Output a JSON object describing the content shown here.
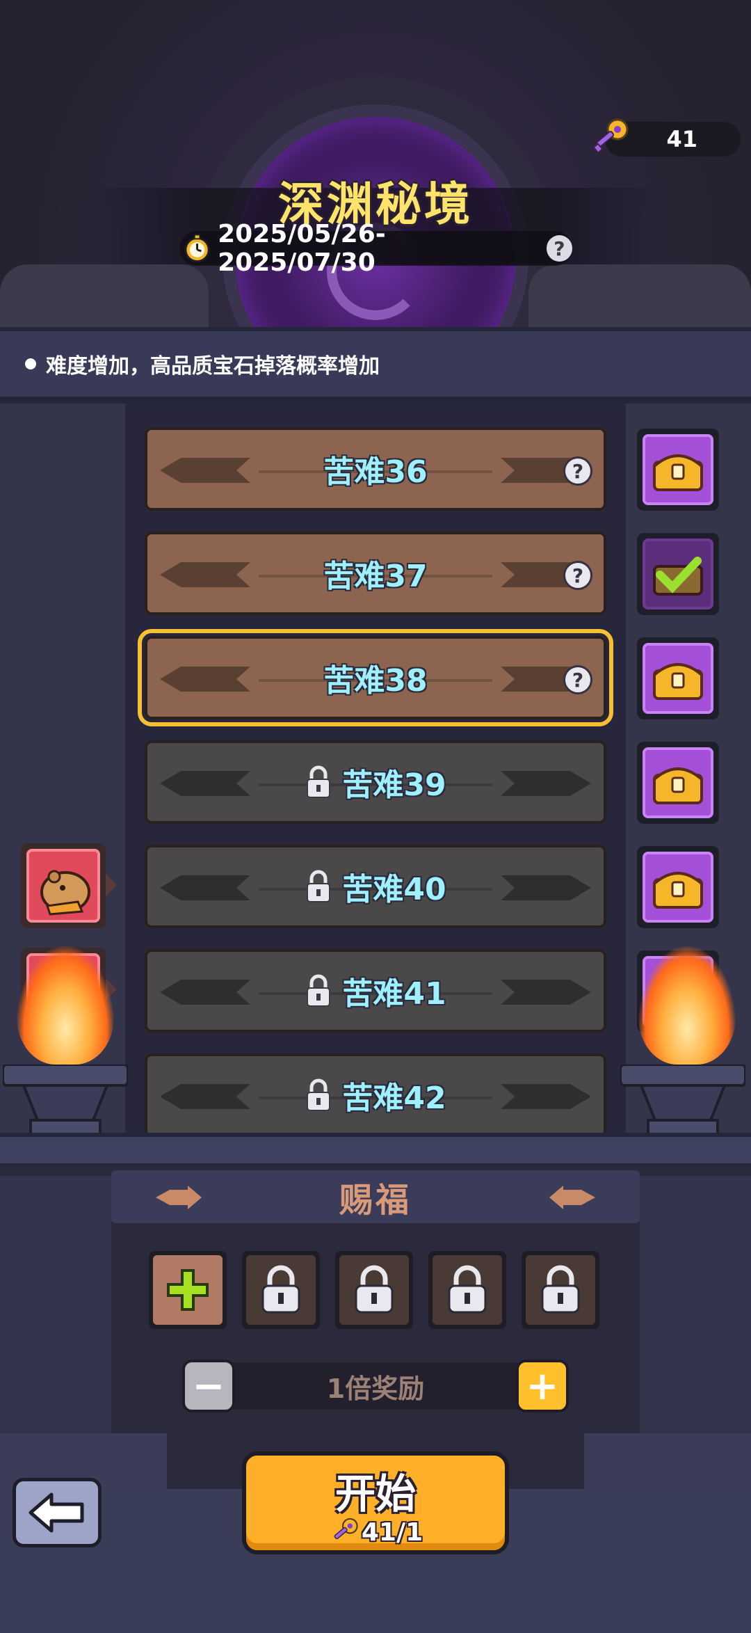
{
  "header": {
    "title": "深渊秘境",
    "date_range": "2025/05/26-2025/07/30",
    "help": "?",
    "key_count": "41"
  },
  "notice": {
    "text": "难度增加，高品质宝石掉落概率增加"
  },
  "levels": [
    {
      "label": "苦难36",
      "state": "unlocked",
      "chest": "available",
      "help": "?"
    },
    {
      "label": "苦难37",
      "state": "unlocked",
      "chest": "claimed",
      "help": "?"
    },
    {
      "label": "苦难38",
      "state": "selected",
      "chest": "available",
      "help": "?"
    },
    {
      "label": "苦难39",
      "state": "locked",
      "chest": "available"
    },
    {
      "label": "苦难40",
      "state": "locked",
      "chest": "available"
    },
    {
      "label": "苦难41",
      "state": "locked",
      "chest": "available"
    },
    {
      "label": "苦难42",
      "state": "locked"
    }
  ],
  "blessing": {
    "title": "赐福",
    "slots": [
      "add",
      "locked",
      "locked",
      "locked",
      "locked"
    ]
  },
  "multiplier": {
    "label": "1倍奖励",
    "minus": "−",
    "plus": "+"
  },
  "start": {
    "label": "开始",
    "cost": "41/1"
  },
  "colors": {
    "title": "#ffe36a",
    "level_text": "#9ff0ff",
    "selected_outline": "#f5c033",
    "start_button": "#ffb028",
    "chest": "#a34fd8"
  }
}
